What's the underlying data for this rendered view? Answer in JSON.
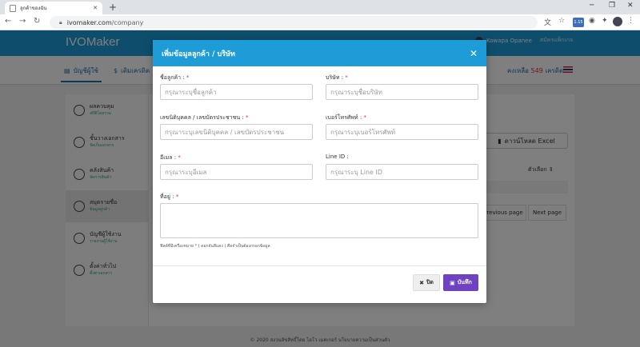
{
  "browser": {
    "tab_title": "ลูกค้าของฉัน",
    "url_host": "ivomaker.com",
    "url_path": "/company",
    "ext_badge": "1.15"
  },
  "app": {
    "logo": "IVOMaker",
    "user_name": "Kowapa Opanee",
    "user_sub": "สมัครแพ็กเกจ",
    "tabs": [
      "บัญชีผู้ใช้",
      "เติมเครดิต"
    ],
    "credits_prefix": "คงเหลือ",
    "credits_value": "549",
    "credits_suffix": "เครดิต",
    "download_label": "ดาวน์โหลด Excel",
    "options_label": "ตัวเลือก",
    "prev_page": "Previous page",
    "next_page": "Next page",
    "footer": "© 2020 สงวนลิขสิทธิ์โดย ไอโว เมคเกอร์ นโยบายความเป็นส่วนตัว"
  },
  "sidebar": {
    "items": [
      {
        "label": "ผลควบคุม",
        "sub": "สถิติโดยรวม"
      },
      {
        "label": "ชั้นวางเอกสาร",
        "sub": "จัดเก็บเอกสาร"
      },
      {
        "label": "คลังสินค้า",
        "sub": "จัดการสินค้า"
      },
      {
        "label": "สมุดรายชื่อ",
        "sub": "ข้อมูลลูกค้า"
      },
      {
        "label": "บัญชีผู้ใช้งาน",
        "sub": "รายงานผู้ใช้งาน"
      },
      {
        "label": "ตั้งค่าทั่วไป",
        "sub": "ตั้งค่าเอกสาร"
      }
    ]
  },
  "modal": {
    "title": "เพิ่มข้อมูลลูกค้า / บริษัท",
    "fields": {
      "customer_name": {
        "label": "ชื่อลูกค้า :",
        "required": "*",
        "placeholder": "กรุณาระบุชื่อลูกค้า",
        "value": ""
      },
      "company": {
        "label": "บริษัท :",
        "required": "*",
        "placeholder": "กรุณาระบุชื่อบริษัท",
        "value": ""
      },
      "tax_id": {
        "label": "เลขนิติบุคคล / เลขบัตรประชาชน :",
        "required": "*",
        "placeholder": "กรุณาระบุเลขนิติบุคคล / เลขบัตรประชาชน",
        "value": ""
      },
      "phone": {
        "label": "เบอร์โทรศัพท์ :",
        "required": "*",
        "placeholder": "กรุณาระบุเบอร์โทรศัพท์",
        "value": ""
      },
      "email": {
        "label": "อีเมล :",
        "required": "*",
        "placeholder": "กรุณาระบุอีเมล",
        "value": ""
      },
      "line_id": {
        "label": "Line ID :",
        "required": "",
        "placeholder": "กรุณาระบุ Line ID",
        "value": ""
      },
      "address": {
        "label": "ที่อยู่ :",
        "required": "*",
        "placeholder": "",
        "value": ""
      }
    },
    "note_prefix": "ฟิลด์ที่มีเครื่องหมาย",
    "note_star": "*",
    "note_suffix": "( ดอกจันสีแดง ) คือจำเป็นต้องกรอกข้อมูล",
    "close_label": "ปิด",
    "save_label": "บันทึก"
  },
  "colors": {
    "header": "#1d9cd8",
    "save": "#6f42c1",
    "required": "#e0313f"
  }
}
